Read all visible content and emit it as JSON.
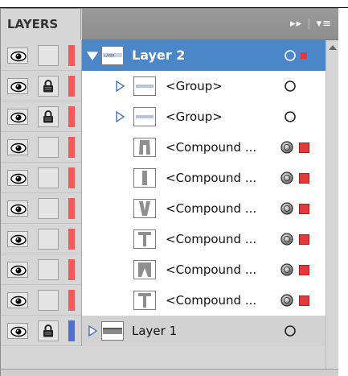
{
  "panel": {
    "title": "LAYERS",
    "menu_expand_glyph": "▸▸",
    "menu_separator": "|",
    "menu_glyph": "▾≡"
  },
  "rows": [
    {
      "name": "Layer 2",
      "kind": "layer",
      "selected": true,
      "locked": false,
      "color": "#f05a5a",
      "expanded": true
    },
    {
      "name": "<Group>",
      "kind": "group",
      "locked": true,
      "color": "#f05a5a"
    },
    {
      "name": "<Group>",
      "kind": "group",
      "locked": true,
      "color": "#f05a5a"
    },
    {
      "name": "<Compound ...",
      "kind": "compound",
      "locked": false,
      "color": "#f05a5a"
    },
    {
      "name": "<Compound ...",
      "kind": "compound",
      "locked": false,
      "color": "#f05a5a"
    },
    {
      "name": "<Compound ...",
      "kind": "compound",
      "locked": false,
      "color": "#f05a5a"
    },
    {
      "name": "<Compound ...",
      "kind": "compound",
      "locked": false,
      "color": "#f05a5a"
    },
    {
      "name": "<Compound ...",
      "kind": "compound",
      "locked": false,
      "color": "#f05a5a"
    },
    {
      "name": "<Compound ...",
      "kind": "compound",
      "locked": false,
      "color": "#f05a5a"
    },
    {
      "name": "Layer 1",
      "kind": "layer",
      "selected": false,
      "locked": true,
      "color": "#5270c8",
      "expanded": false
    }
  ],
  "icons": {
    "visibility": "eye-icon",
    "lock": "lock-icon",
    "expand": "triangle-icon",
    "target": "target-circle-icon"
  }
}
